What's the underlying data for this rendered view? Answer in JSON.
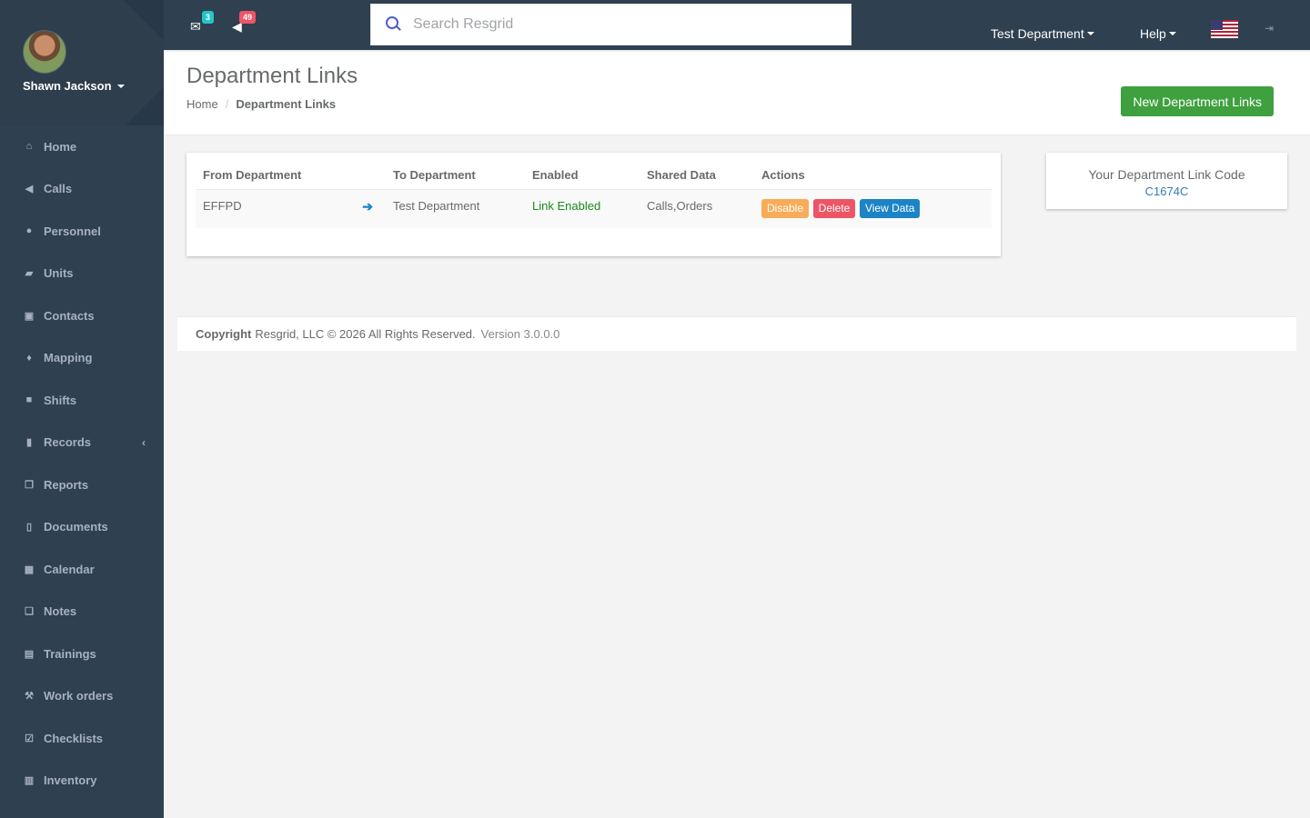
{
  "user": {
    "name": "Shawn Jackson"
  },
  "sidebar": {
    "items": [
      {
        "label": "Home",
        "icon": "home-icon"
      },
      {
        "label": "Calls",
        "icon": "bullhorn-icon"
      },
      {
        "label": "Personnel",
        "icon": "user-icon"
      },
      {
        "label": "Units",
        "icon": "truck-icon"
      },
      {
        "label": "Contacts",
        "icon": "address-book-icon"
      },
      {
        "label": "Mapping",
        "icon": "map-marker-icon"
      },
      {
        "label": "Shifts",
        "icon": "briefcase-icon"
      },
      {
        "label": "Records",
        "icon": "file-icon",
        "has_submenu": true
      },
      {
        "label": "Reports",
        "icon": "copy-icon"
      },
      {
        "label": "Documents",
        "icon": "document-icon"
      },
      {
        "label": "Calendar",
        "icon": "calendar-icon"
      },
      {
        "label": "Notes",
        "icon": "notes-icon"
      },
      {
        "label": "Trainings",
        "icon": "book-icon"
      },
      {
        "label": "Work orders",
        "icon": "wrench-icon"
      },
      {
        "label": "Checklists",
        "icon": "checkbox-icon"
      },
      {
        "label": "Inventory",
        "icon": "barcode-icon"
      }
    ]
  },
  "topbar": {
    "messages_count": "3",
    "calls_count": "49",
    "search_placeholder": "Search Resgrid",
    "department": "Test Department",
    "help": "Help"
  },
  "page": {
    "title": "Department Links",
    "breadcrumb": {
      "home": "Home",
      "current": "Department Links"
    },
    "new_button": "New Department Links"
  },
  "table": {
    "headers": [
      "From Department",
      "To Department",
      "Enabled",
      "Shared Data",
      "Actions"
    ],
    "rows": [
      {
        "from": "EFFPD",
        "to": "Test Department",
        "enabled": "Link Enabled",
        "shared": "Calls,Orders",
        "actions": {
          "disable": "Disable",
          "delete": "Delete",
          "view": "View Data"
        }
      }
    ]
  },
  "link_code": {
    "label": "Your Department Link Code",
    "value": "C1674C"
  },
  "footer": {
    "copyright_label": "Copyright",
    "copyright_text": "Resgrid, LLC © 2026 All Rights Reserved.",
    "version": "Version 3.0.0.0"
  },
  "colors": {
    "sidebar": "#2f4050",
    "primary_green": "#3ea03e",
    "warning": "#f8ac59",
    "danger": "#ed5565",
    "info": "#1c84c6",
    "link": "#337ab7"
  }
}
